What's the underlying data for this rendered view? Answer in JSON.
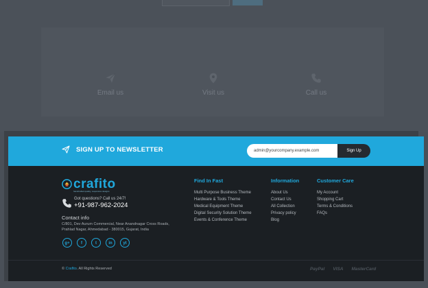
{
  "contact_strip": {
    "items": [
      {
        "label": "Email us",
        "icon": "paper-plane-icon"
      },
      {
        "label": "Visit us",
        "icon": "map-pin-icon"
      },
      {
        "label": "Call us",
        "icon": "phone-icon"
      }
    ]
  },
  "newsletter": {
    "title": "SIGN UP TO NEWSLETTER",
    "input_value": "admin@yourcompany.example.com",
    "button_label": "Sign Up"
  },
  "brand": {
    "logo_text": "crafito",
    "tagline": "handcrafted quality, responsive designs",
    "accent_color": "#20a8dc"
  },
  "contact": {
    "question": "Got questions? Call us 24/7!",
    "phone": "+91-987-962-2024",
    "title": "Contact info",
    "address_line1": "C/801, Dev Aurum Commercial, Near Anandnagar Cross Roads,",
    "address_line2": "Prahlad Nagar, Ahmedabad - 380015, Gujarat, India"
  },
  "socials": [
    "g+",
    "f",
    "t",
    "in",
    "yt"
  ],
  "columns": [
    {
      "title": "Find In Fast",
      "items": [
        "Multi Purpose Business Theme",
        "Hardware & Tools Theme",
        "Medical Equipment Theme",
        "Digital Security Solution Theme",
        "Events & Conference Theme"
      ]
    },
    {
      "title": "Information",
      "items": [
        "About Us",
        "Contact Us",
        "All Collection",
        "Privacy policy",
        "Blog"
      ]
    },
    {
      "title": "Customer Care",
      "items": [
        "My Account",
        "Shopping Cart",
        "Terms & Conditions",
        "FAQs"
      ]
    }
  ],
  "footer_bottom": {
    "copyright_prefix": "©",
    "copyright_brand": "Crafito",
    "copyright_suffix": ". All Rights Reserved",
    "payments": [
      "PayPal",
      "VISA",
      "MasterCard"
    ]
  }
}
